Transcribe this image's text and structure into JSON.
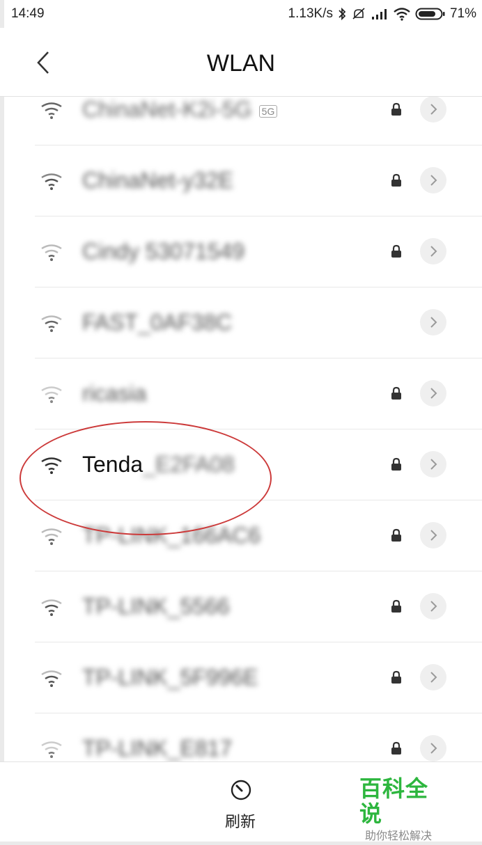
{
  "statusbar": {
    "time": "14:49",
    "net_speed": "1.13K/s",
    "battery": "71%"
  },
  "header": {
    "title": "WLAN"
  },
  "networks": [
    {
      "ssid": "ChinaNet-K2i-5G",
      "band": "5G",
      "locked": true
    },
    {
      "ssid": "ChinaNet-y32E",
      "locked": true
    },
    {
      "ssid": "Cindy 53071549",
      "locked": true
    },
    {
      "ssid": "FAST_0AF38C",
      "locked": false
    },
    {
      "ssid": "ricasia",
      "locked": true
    },
    {
      "ssid_visible": "Tenda",
      "ssid_hidden": "_E2FA08",
      "locked": true
    },
    {
      "ssid": "TP-LINK_166AC6",
      "locked": true
    },
    {
      "ssid": "TP-LINK_5566",
      "locked": true
    },
    {
      "ssid": "TP-LINK_5F996E",
      "locked": true
    },
    {
      "ssid": "TP-LINK_E817",
      "locked": true
    }
  ],
  "bottom": {
    "refresh_label": "刷新"
  },
  "watermark": {
    "title": "百科全说",
    "subtitle": "助你轻松解决"
  },
  "colors": {
    "highlight": "#cc3a3a",
    "watermark": "#2db63e"
  }
}
